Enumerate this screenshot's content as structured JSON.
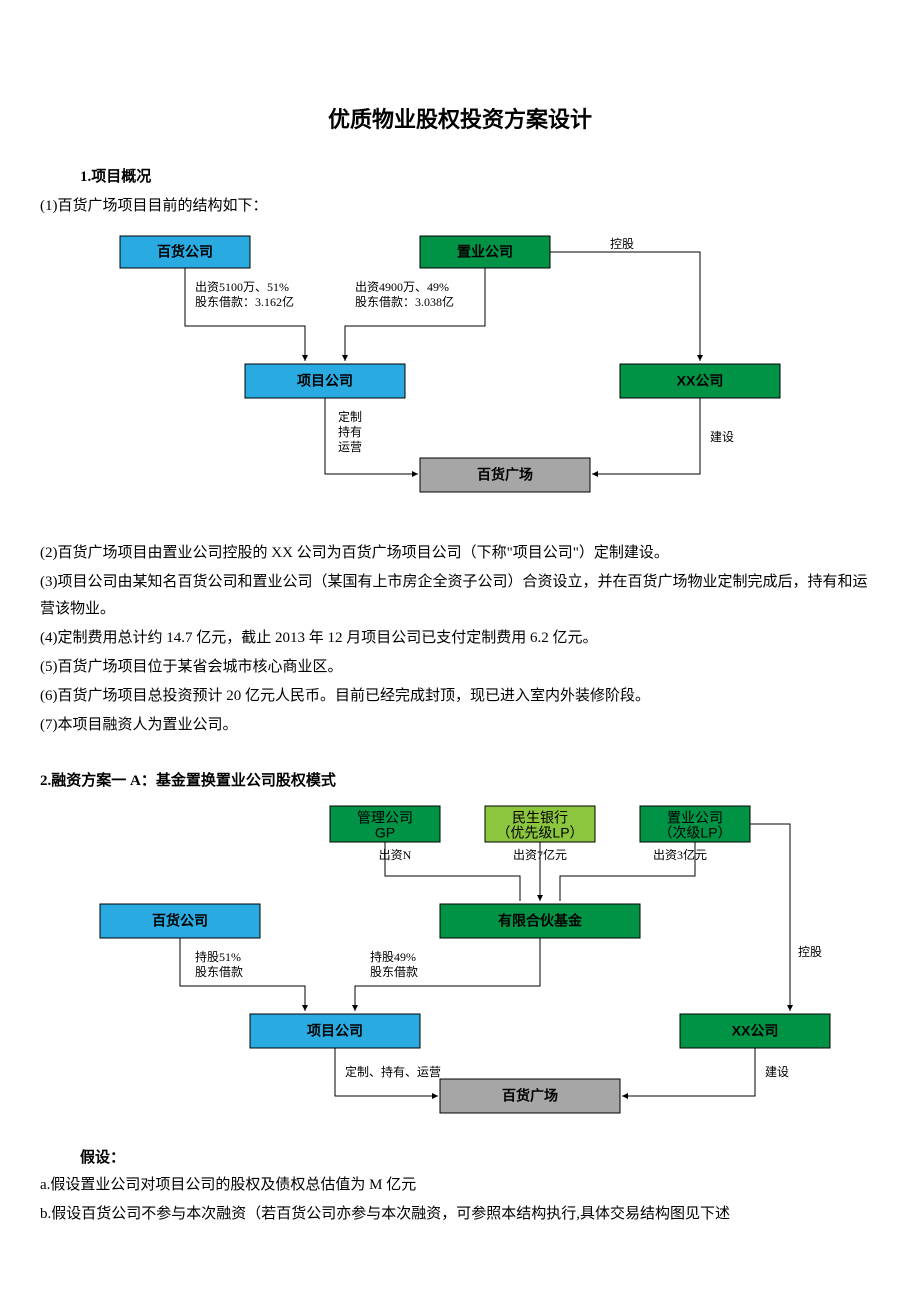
{
  "title": "优质物业股权投资方案设计",
  "section1": {
    "heading": "1.项目概况",
    "intro": "(1)百货广场项目目前的结构如下：",
    "diagram1": {
      "baihuo_gongsi": "百货公司",
      "zhiye_gongsi": "置业公司",
      "xiangmu_gongsi": "项目公司",
      "xx_gongsi": "XX公司",
      "baihuo_guangchang": "百货广场",
      "lbl_51_a": "出资5100万、51%",
      "lbl_51_b": "股东借款：3.162亿",
      "lbl_49_a": "出资4900万、49%",
      "lbl_49_b": "股东借款：3.038亿",
      "lbl_konggu": "控股",
      "lbl_dingzhi": "定制",
      "lbl_chiyou": "持有",
      "lbl_yunying": "运营",
      "lbl_jianshe": "建设"
    },
    "p2": "(2)百货广场项目由置业公司控股的 XX 公司为百货广场项目公司（下称\"项目公司\"）定制建设。",
    "p3": "(3)项目公司由某知名百货公司和置业公司（某国有上市房企全资子公司）合资设立，并在百货广场物业定制完成后，持有和运营该物业。",
    "p4": "(4)定制费用总计约 14.7 亿元，截止 2013 年 12 月项目公司已支付定制费用 6.2 亿元。",
    "p5": "(5)百货广场项目位于某省会城市核心商业区。",
    "p6": "(6)百货广场项目总投资预计 20 亿元人民币。目前已经完成封顶，现已进入室内外装修阶段。",
    "p7": "(7)本项目融资人为置业公司。"
  },
  "section2": {
    "heading": "2.融资方案一 A：基金置换置业公司股权模式",
    "diagram2": {
      "guanli_gp_1": "管理公司",
      "guanli_gp_2": "GP",
      "minsheng_1": "民生银行",
      "minsheng_2": "（优先级LP）",
      "zhiye_ci_1": "置业公司",
      "zhiye_ci_2": "（次级LP）",
      "chuzi_n": "出资N",
      "chuzi_7": "出资7亿元",
      "chuzi_3": "出资3亿元",
      "baihuo_gongsi": "百货公司",
      "hehuo_jijin": "有限合伙基金",
      "lbl_51": "持股51%",
      "lbl_51b": "股东借款",
      "lbl_49": "持股49%",
      "lbl_49b": "股东借款",
      "lbl_konggu": "控股",
      "xiangmu_gongsi": "项目公司",
      "xx_gongsi": "XX公司",
      "lbl_dcy": "定制、持有、运营",
      "lbl_jianshe": "建设",
      "baihuo_guangchang": "百货广场"
    },
    "assume_head": "假设：",
    "assume_a": "a.假设置业公司对项目公司的股权及债权总估值为 M 亿元",
    "assume_b": "b.假设百货公司不参与本次融资（若百货公司亦参与本次融资，可参照本结构执行,具体交易结构图见下述"
  }
}
